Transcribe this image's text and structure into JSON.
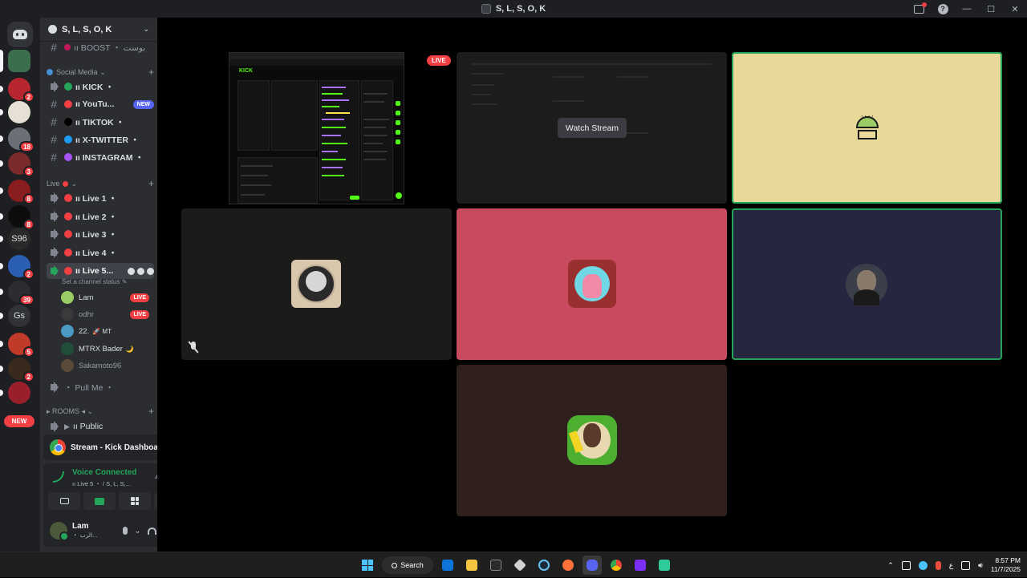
{
  "window": {
    "title": "S, L, S, O, K",
    "controls": {
      "minimize": "—",
      "maximize": "☐",
      "close": "✕",
      "help": "?"
    }
  },
  "rail": {
    "new_label": "NEW",
    "servers": [
      {
        "label": "",
        "color": "#3b6e4d",
        "mention": "",
        "selected": true
      },
      {
        "label": "",
        "color": "#b8262f",
        "mention": "2"
      },
      {
        "label": "",
        "color": "#e6e0d5",
        "mention": ""
      },
      {
        "label": "",
        "color": "#6b6f78",
        "mention": "18"
      },
      {
        "label": "",
        "color": "#7a2a2a",
        "mention": "3"
      },
      {
        "label": "",
        "color": "#8a1d1d",
        "mention": "8"
      },
      {
        "label": "",
        "color": "#0d0d0d",
        "mention": "8"
      },
      {
        "label": "S96",
        "color": "#2a2a2a",
        "mention": ""
      },
      {
        "label": "",
        "color": "#2b5fb4",
        "mention": "2"
      },
      {
        "label": "",
        "color": "#2b2d31",
        "mention": "39"
      },
      {
        "label": "Gs",
        "color": "#313338",
        "mention": ""
      },
      {
        "label": "",
        "color": "#c23a2a",
        "mention": "5"
      },
      {
        "label": "",
        "color": "#3a2a1d",
        "mention": "2"
      },
      {
        "label": "",
        "color": "#9a1f2d",
        "mention": ""
      }
    ]
  },
  "sidebar": {
    "server_name": "S, L, S, O, K",
    "channels_top": [
      {
        "label": "ıı BOOST ・ بوست",
        "kind": "text",
        "dot": "#c2185b"
      }
    ],
    "social_category": "Social Media",
    "social": [
      {
        "label": "ıı KICK ・",
        "kind": "voice",
        "dot": "#23a55a"
      },
      {
        "label": "ıı YouTu...",
        "kind": "text",
        "dot": "#f23f43",
        "badge": "NEW"
      },
      {
        "label": "ıı TIKTOK ・",
        "kind": "text",
        "dot": "#000000"
      },
      {
        "label": "ıı X-TWITTER ・",
        "kind": "text",
        "dot": "#1d9bf0"
      },
      {
        "label": "ıı INSTAGRAM ・",
        "kind": "text",
        "dot": "#a855f7"
      }
    ],
    "live_category": "Live",
    "live": [
      {
        "label": "ıı Live 1 ・",
        "dot": "#f23f43"
      },
      {
        "label": "ıı Live 2 ・",
        "dot": "#f23f43"
      },
      {
        "label": "ıı Live 3 ・",
        "dot": "#f23f43"
      },
      {
        "label": "ıı Live 4 ・",
        "dot": "#f23f43"
      },
      {
        "label": "ıı Live 5...",
        "dot": "#f23f43",
        "active": true
      }
    ],
    "channel_status": "Set a channel status",
    "voice_users": [
      {
        "name": "Lam",
        "avatar": "#9ccc65",
        "badge": "LIVE",
        "bright": true
      },
      {
        "name": "odhr",
        "avatar": "#3a3a3a",
        "badge": "LIVE",
        "bright": false
      },
      {
        "name": "22.",
        "avatar": "#4a9ac4",
        "extra": "🚀 MT",
        "bright": true
      },
      {
        "name": "MTRX Bader",
        "avatar": "#1f4f3a",
        "extra": "🌙",
        "bright": true
      },
      {
        "name": "Sakamoto96",
        "avatar": "#5a4a3a",
        "bright": false
      }
    ],
    "pull_me": "・ Pull Me ・",
    "rooms_category": "ROOMS",
    "public": "ıı Public"
  },
  "stream_panel": {
    "title": "Stream - Kick Dashboar..."
  },
  "voice_panel": {
    "status": "Voice Connected",
    "channel": "ıı Live 5 ・ / S, L, S,..."
  },
  "user_panel": {
    "name": "Lam",
    "status": "・ الرب..."
  },
  "stage": {
    "live_tag": "LIVE",
    "watch_label": "Watch Stream",
    "kick_brand": "KICK"
  },
  "taskbar": {
    "search": "Search",
    "time": "8:57 PM",
    "date": "11/7/2025",
    "lang": "ع"
  },
  "colors": {
    "accent_green": "#23a55a",
    "danger_red": "#f23f43",
    "blurple": "#5865f2",
    "kick_green": "#53fc18"
  }
}
